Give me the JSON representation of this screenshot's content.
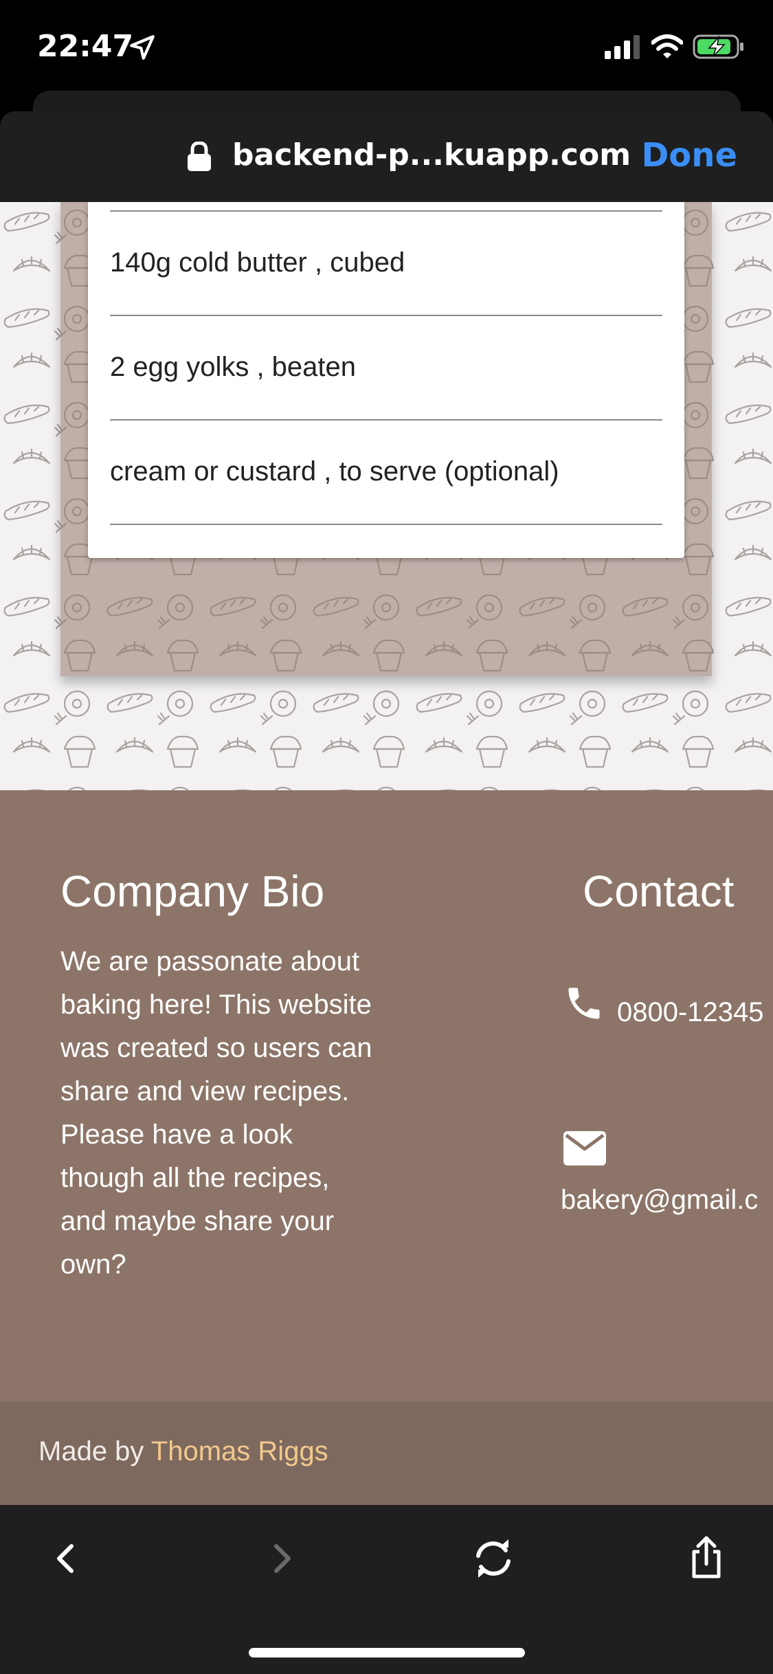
{
  "status_bar": {
    "time": "22:47"
  },
  "browser": {
    "url": "backend-p...kuapp.com",
    "done_label": "Done"
  },
  "ingredients": [
    "140g cold butter , cubed",
    "2 egg yolks , beaten",
    "cream or custard , to serve (optional)"
  ],
  "footer": {
    "bio_title": "Company Bio",
    "bio_text": "We are passonate about baking here! This website was created so users can share and view recipes. Please have a look though all the recipes, and maybe share your own?",
    "contact_title": "Contact",
    "phone": "0800-12345",
    "email": "bakery@gmail.c",
    "credit_prefix": "Made by ",
    "credit_name": "Thomas Riggs"
  },
  "toolbar": {
    "back_icon": "chevron-left-icon",
    "forward_icon": "chevron-right-icon",
    "reload_icon": "reload-icon",
    "share_icon": "share-icon"
  },
  "colors": {
    "footer_bg": "#8c7568",
    "credit_bg": "#7e695e",
    "link": "#f2c98e",
    "done": "#3a8ef6"
  }
}
